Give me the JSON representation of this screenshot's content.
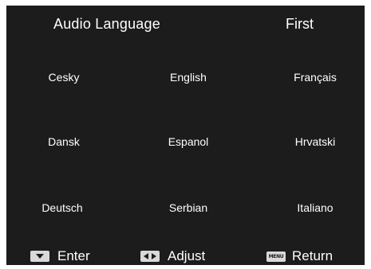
{
  "header": {
    "title": "Audio Language",
    "value": "First"
  },
  "languages": [
    [
      "Cesky",
      "English",
      "Français"
    ],
    [
      "Dansk",
      "Espanol",
      "Hrvatski"
    ],
    [
      "Deutsch",
      "Serbian",
      "Italiano"
    ]
  ],
  "footer": {
    "enter": {
      "icon": "down-arrow-key-icon",
      "label": "Enter"
    },
    "adjust": {
      "icon": "left-right-arrow-key-icon",
      "label": "Adjust"
    },
    "return": {
      "icon": "menu-key-icon",
      "key_text": "MENU",
      "label": "Return"
    }
  },
  "colors": {
    "background": "#1c1c1c",
    "text": "#ffffff",
    "key_icon": "#d9d9d9"
  }
}
